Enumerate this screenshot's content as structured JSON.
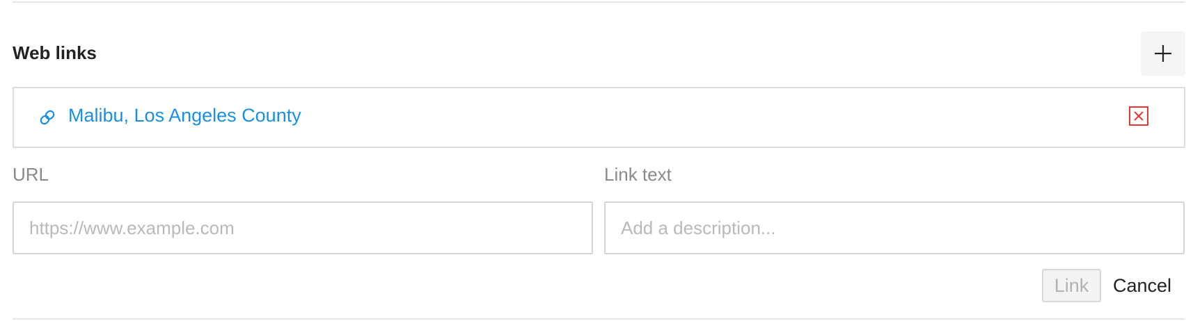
{
  "section": {
    "title": "Web links"
  },
  "add_button": {
    "icon": "plus-icon"
  },
  "links": [
    {
      "icon": "link-icon",
      "text": "Malibu, Los Angeles County",
      "remove_icon": "close-box-icon"
    }
  ],
  "form": {
    "url_label": "URL",
    "url_placeholder": "https://www.example.com",
    "url_value": "",
    "text_label": "Link text",
    "text_placeholder": "Add a description...",
    "text_value": "",
    "link_button": "Link",
    "cancel_button": "Cancel"
  },
  "colors": {
    "link": "#1a8fe8",
    "remove": "#e53935",
    "label": "#8a8a8a",
    "disabled_text": "#b2b2b2"
  }
}
